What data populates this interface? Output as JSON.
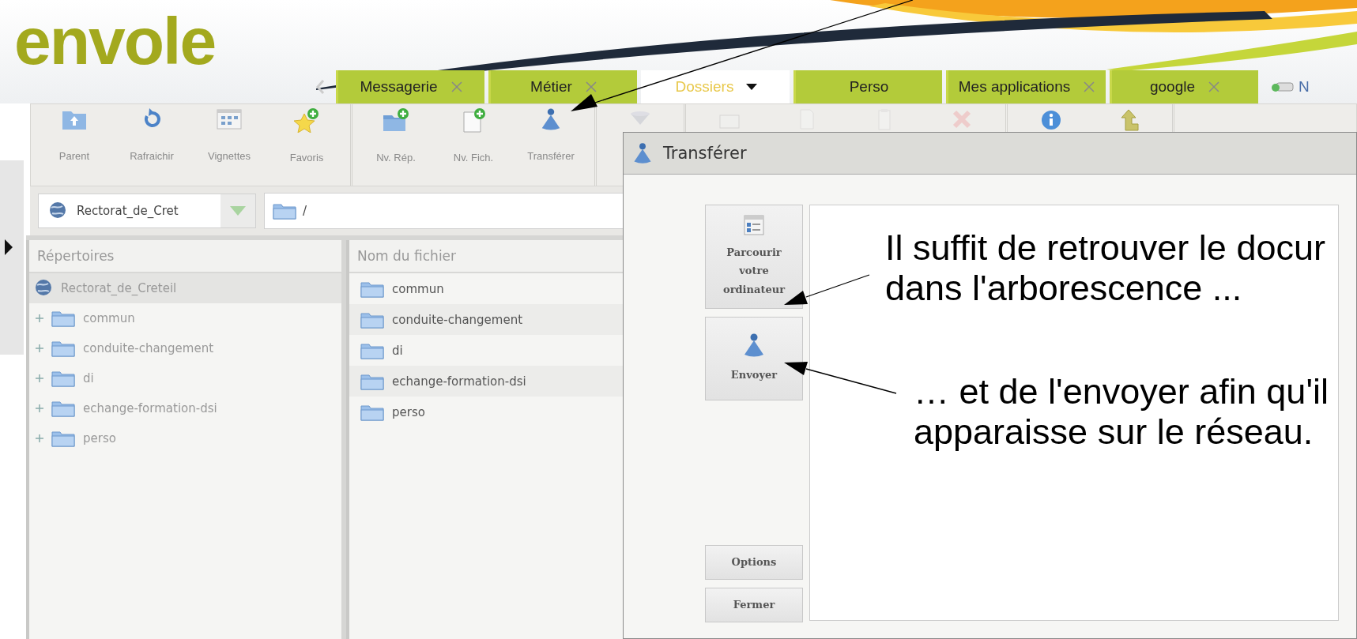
{
  "logo": "envole",
  "tabs": [
    {
      "label": "Messagerie",
      "selected": false,
      "closable": true,
      "dropdown": false
    },
    {
      "label": "Métier",
      "selected": false,
      "closable": true,
      "dropdown": false
    },
    {
      "label": "Dossiers",
      "selected": true,
      "closable": false,
      "dropdown": true
    },
    {
      "label": "Perso",
      "selected": false,
      "closable": false,
      "dropdown": false
    },
    {
      "label": "Mes applications",
      "selected": false,
      "closable": true,
      "dropdown": false
    },
    {
      "label": "google",
      "selected": false,
      "closable": true,
      "dropdown": false
    }
  ],
  "tab_bar_extra": {
    "label": "N"
  },
  "toolbar": {
    "groups": [
      {
        "items": [
          {
            "kind": "parent",
            "label": "Parent",
            "disabled": false
          },
          {
            "kind": "refresh",
            "label": "Rafraichir",
            "disabled": false
          },
          {
            "kind": "thumbnails",
            "label": "Vignettes",
            "disabled": false
          },
          {
            "kind": "favorites",
            "label": "Favoris",
            "disabled": false
          }
        ]
      },
      {
        "items": [
          {
            "kind": "new-folder",
            "label": "Nv. Rép.",
            "disabled": false
          },
          {
            "kind": "new-file",
            "label": "Nv. Fich.",
            "disabled": false
          },
          {
            "kind": "transfer",
            "label": "Transférer",
            "disabled": false
          }
        ]
      },
      {
        "items": [
          {
            "kind": "filter",
            "disabled": true
          }
        ]
      },
      {
        "items": [
          {
            "kind": "window",
            "disabled": true
          },
          {
            "kind": "copy",
            "disabled": true
          },
          {
            "kind": "paste",
            "disabled": true
          },
          {
            "kind": "delete",
            "disabled": true
          }
        ]
      },
      {
        "items": [
          {
            "kind": "info",
            "disabled": false
          },
          {
            "kind": "up",
            "disabled": false
          }
        ]
      }
    ]
  },
  "location": {
    "drive": "Rectorat_de_Cret",
    "path": "/"
  },
  "tree": {
    "header": "Répertoires",
    "items": [
      {
        "label": "Rectorat_de_Creteil",
        "selected": true,
        "children": [
          {
            "label": "commun",
            "selected": false,
            "expanded": false
          },
          {
            "label": "conduite-changement",
            "selected": false,
            "expanded": false
          },
          {
            "label": "di",
            "selected": false,
            "expanded": false
          },
          {
            "label": "echange-formation-dsi",
            "selected": false,
            "expanded": false
          },
          {
            "label": "perso",
            "selected": false,
            "expanded": false
          }
        ]
      }
    ]
  },
  "files": {
    "columns": [
      "Nom du fichier"
    ],
    "rows": [
      {
        "name": "commun"
      },
      {
        "name": "conduite-changement"
      },
      {
        "name": "di"
      },
      {
        "name": "echange-formation-dsi"
      },
      {
        "name": "perso"
      }
    ]
  },
  "dialog": {
    "title": "Transférer",
    "buttons": [
      {
        "kind": "browse",
        "label": "Parcourir votre ordinateur"
      },
      {
        "kind": "send",
        "label": "Envoyer"
      },
      {
        "kind": "plain",
        "label": "Options"
      },
      {
        "kind": "plain",
        "label": "Fermer"
      }
    ]
  },
  "annotations": [
    {
      "lines": [
        "Il suffit de retrouver le docur",
        "dans l'arborescence ..."
      ]
    },
    {
      "lines": [
        "… et de l'envoyer afin qu'il",
        "apparaisse sur le réseau."
      ]
    }
  ]
}
